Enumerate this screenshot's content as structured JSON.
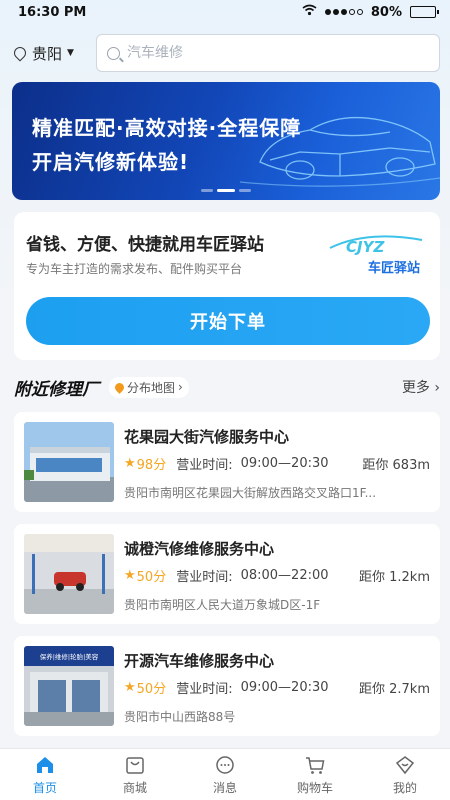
{
  "status_bar": {
    "time": "16:30 PM",
    "battery": "80%",
    "battery_level": 0.8
  },
  "header": {
    "city": "贵阳",
    "search_placeholder": "汽车维修"
  },
  "banner": {
    "line1": "精准匹配·高效对接·全程保障",
    "line2": "开启汽修新体验!"
  },
  "promo": {
    "headline": "省钱、方便、快捷就用车匠驿站",
    "subtitle": "专为车主打造的需求发布、配件购买平台",
    "logo_text": "CJYZ",
    "logo_name": "车匠驿站",
    "cta_label": "开始下单"
  },
  "nearby": {
    "title": "附近修理厂",
    "map_label": "分布地图",
    "more_label": "更多"
  },
  "shops": [
    {
      "name": "花果园大街汽修服务中心",
      "score": "98分",
      "hours_label": "营业时间:",
      "hours": "09:00—20:30",
      "distance": "距你 683m",
      "address": "贵阳市南明区花果园大街解放西路交叉路口1F..."
    },
    {
      "name": "诚橙汽修维修服务中心",
      "score": "50分",
      "hours_label": "营业时间:",
      "hours": "08:00—22:00",
      "distance": "距你 1.2km",
      "address": "贵阳市南明区人民大道万象城D区-1F"
    },
    {
      "name": "开源汽车维修服务中心",
      "score": "50分",
      "hours_label": "营业时间:",
      "hours": "09:00—20:30",
      "distance": "距你 2.7km",
      "address": "贵阳市中山西路88号",
      "sign_text": "保养|维修|轮胎|美容"
    }
  ],
  "tabbar": [
    {
      "label": "首页",
      "icon": "home-icon",
      "active": true
    },
    {
      "label": "商城",
      "icon": "mall-icon",
      "active": false
    },
    {
      "label": "消息",
      "icon": "message-icon",
      "active": false
    },
    {
      "label": "购物车",
      "icon": "cart-icon",
      "active": false
    },
    {
      "label": "我的",
      "icon": "profile-icon",
      "active": false
    }
  ],
  "colors": {
    "accent": "#1d9ff0",
    "score": "#f5a623",
    "banner": "#1247b8"
  }
}
